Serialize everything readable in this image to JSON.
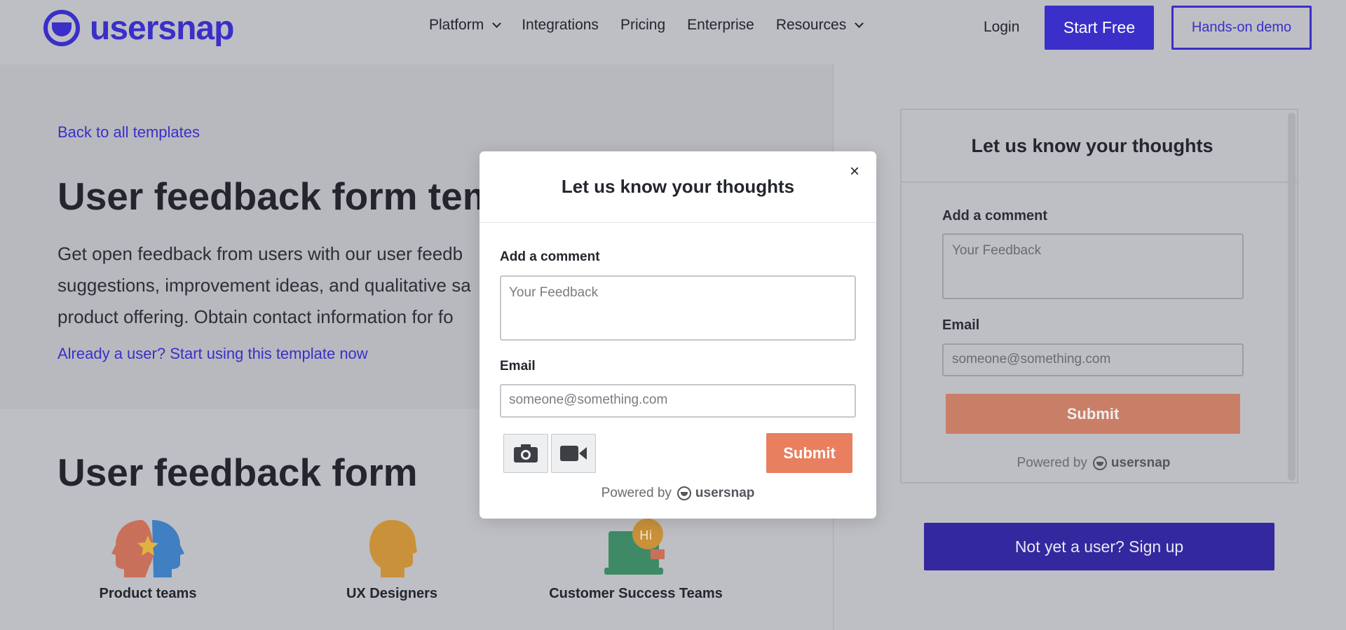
{
  "header": {
    "logo_text": "usersnap",
    "nav": [
      {
        "label": "Platform",
        "has_dropdown": true
      },
      {
        "label": "Integrations",
        "has_dropdown": false
      },
      {
        "label": "Pricing",
        "has_dropdown": false
      },
      {
        "label": "Enterprise",
        "has_dropdown": false
      },
      {
        "label": "Resources",
        "has_dropdown": true
      }
    ],
    "login": "Login",
    "start_free": "Start Free",
    "demo": "Hands-on demo"
  },
  "hero": {
    "back_link": "Back to all templates",
    "title": "User feedback form templ",
    "description_lines": [
      "Get open feedback from users with our user feedb",
      "suggestions, improvement ideas, and qualitative sa",
      "product offering. Obtain contact information for fo"
    ],
    "already_user": "Already a user? Start using this template now"
  },
  "section": {
    "title": "User feedback form",
    "personas": [
      {
        "label": "Product teams",
        "icon": "heads-star-icon"
      },
      {
        "label": "UX Designers",
        "icon": "head-icon"
      },
      {
        "label": "Customer Success Teams",
        "icon": "laptop-chat-icon"
      }
    ]
  },
  "preview": {
    "title": "Let us know your thoughts",
    "comment_label": "Add a comment",
    "comment_placeholder": "Your Feedback",
    "email_label": "Email",
    "email_placeholder": "someone@something.com",
    "submit": "Submit",
    "powered_by": "Powered by",
    "powered_brand": "usersnap"
  },
  "signup": "Not yet a user? Sign up",
  "modal": {
    "title": "Let us know your thoughts",
    "close": "×",
    "comment_label": "Add a comment",
    "comment_placeholder": "Your Feedback",
    "email_label": "Email",
    "email_placeholder": "someone@something.com",
    "submit": "Submit",
    "powered_by": "Powered by",
    "powered_brand": "usersnap"
  },
  "colors": {
    "brand": "#3a2fc8",
    "submit": "#e8805f",
    "overlay_bg": "#bebfc4"
  }
}
